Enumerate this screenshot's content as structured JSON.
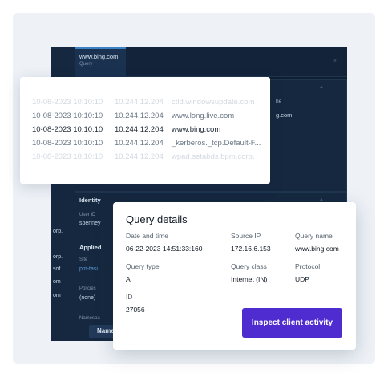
{
  "dark_window": {
    "tab_title": "www.bing.com",
    "tab_subtitle": "Query",
    "close_glyph": "×",
    "ms_line": "he",
    "host_line": "g.com",
    "identity_heading": "Identity",
    "user_id_label": "User ID",
    "user_id_value": "spenney",
    "applied_heading": "Applied",
    "site_label": "Site",
    "site_value": "pm-tasi",
    "policies_label": "Policies",
    "policies_value": "(none)",
    "namespace_label": "Namespa",
    "name_button": "Name",
    "left_fragments": [
      "orp.",
      "orp.",
      "sof...",
      "om",
      "om"
    ]
  },
  "query_list": {
    "rows": [
      {
        "date": "10-08-2023 10:10:10",
        "ip": "10.244.12.204",
        "host": "ctld.windowsupdate.com",
        "style": "faint"
      },
      {
        "date": "10-08-2023 10:10:10",
        "ip": "10.244.12.204",
        "host": "www.long.live.com",
        "style": "mid"
      },
      {
        "date": "10-08-2023 10:10:10",
        "ip": "10.244.12.204",
        "host": "www.bing.com",
        "style": "main"
      },
      {
        "date": "10-08-2023 10:10:10",
        "ip": "10.244.12.204",
        "host": "_kerberos._tcp.Default-F...",
        "style": "mid"
      },
      {
        "date": "10-08-2023 10:10:10",
        "ip": "10.244.12.204",
        "host": "wpad.setabds.bpm.corp.",
        "style": "faint"
      }
    ]
  },
  "query_details": {
    "title": "Query details",
    "date_time_label": "Date and time",
    "date_time_value": "06-22-2023 14:51:33:160",
    "source_ip_label": "Source IP",
    "source_ip_value": "172.16.6.153",
    "query_name_label": "Query name",
    "query_name_value": "www.bing.com",
    "query_type_label": "Query type",
    "query_type_value": "A",
    "query_class_label": "Query class",
    "query_class_value": "Internet (IN)",
    "protocol_label": "Protocol",
    "protocol_value": "UDP",
    "id_label": "ID",
    "id_value": "27056",
    "inspect_button": "Inspect client activity",
    "accent_color": "#4f2ccf"
  }
}
